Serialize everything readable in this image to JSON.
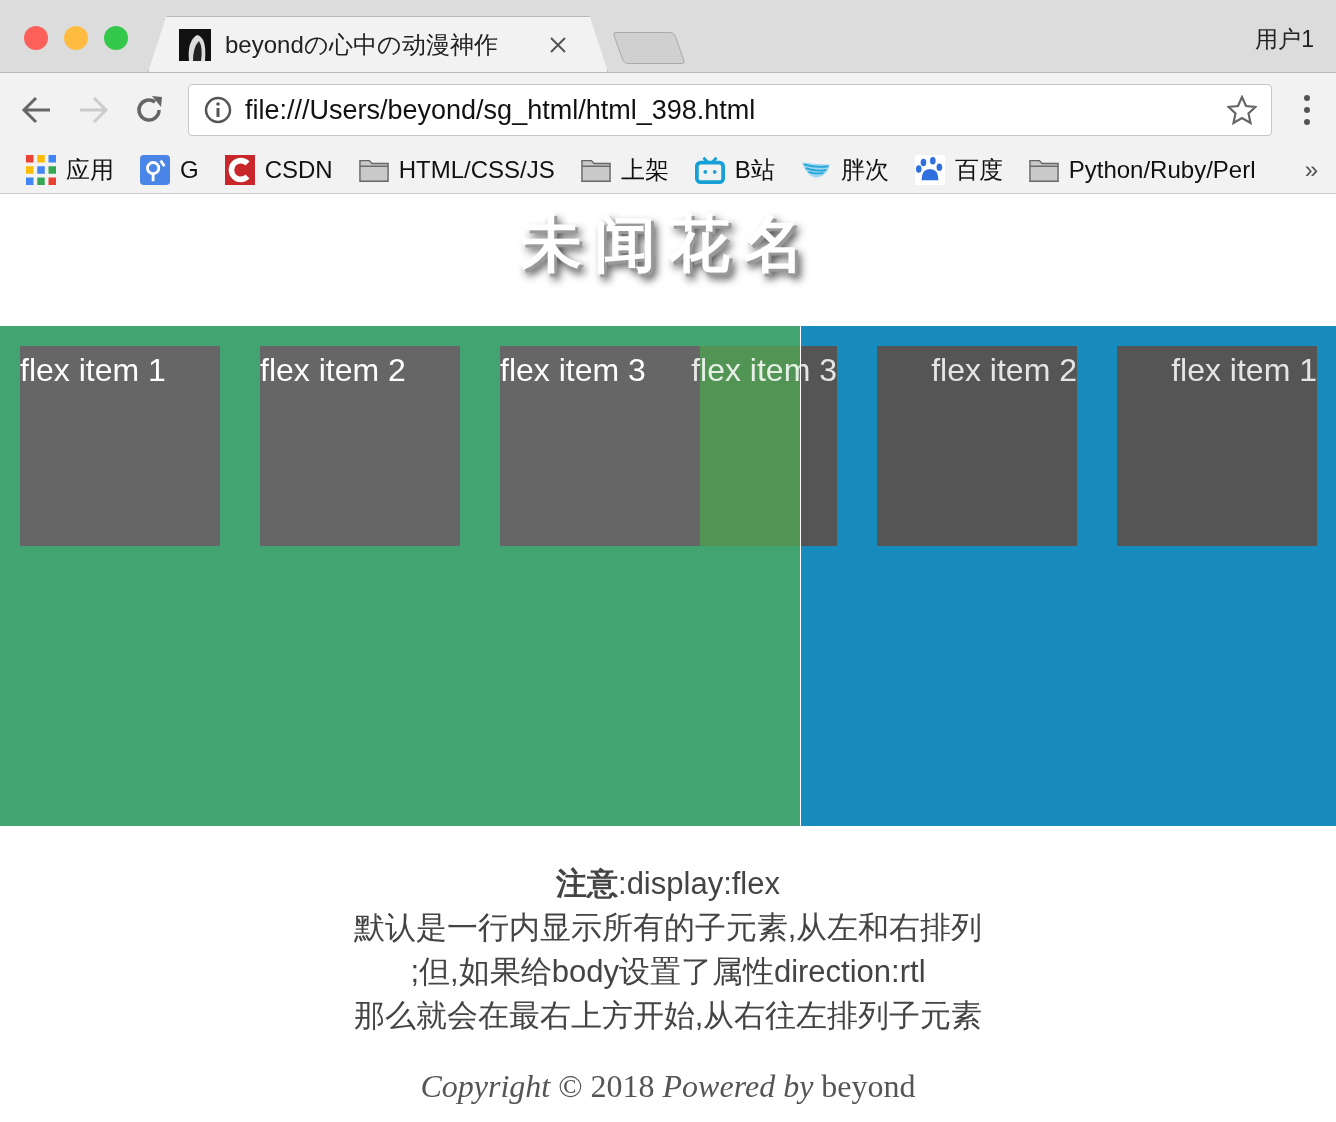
{
  "browser": {
    "tab_title": "beyondの心中の动漫神作",
    "profile": "用户1",
    "url": "file:///Users/beyond/sg_html/html_398.html",
    "bookmarks": [
      {
        "kind": "apps",
        "label": "应用"
      },
      {
        "kind": "g",
        "label": "G"
      },
      {
        "kind": "csdn",
        "label": "CSDN"
      },
      {
        "kind": "folder",
        "label": "HTML/CSS/JS"
      },
      {
        "kind": "folder",
        "label": "上架"
      },
      {
        "kind": "tv",
        "label": "B站"
      },
      {
        "kind": "wave",
        "label": "胖次"
      },
      {
        "kind": "paw",
        "label": "百度"
      },
      {
        "kind": "folder",
        "label": "Python/Ruby/Perl"
      }
    ],
    "more": "»"
  },
  "page": {
    "heading": "未闻花名",
    "rtl_panel": {
      "items": [
        "flex item 3",
        "flex item 2",
        "flex item 1"
      ]
    },
    "ltr_panel": {
      "items": [
        "flex item 1",
        "flex item 2",
        "flex item 3"
      ]
    },
    "notes": [
      "**注意**:display:flex",
      "默认是一行内显示所有的子元素,从左和右排列",
      ";但,如果给body设置了属性direction:rtl",
      "那么就会在最右上方开始,从右往左排列子元素"
    ],
    "footer": "*Copyright* © 2018 *Powered by* beyond"
  }
}
